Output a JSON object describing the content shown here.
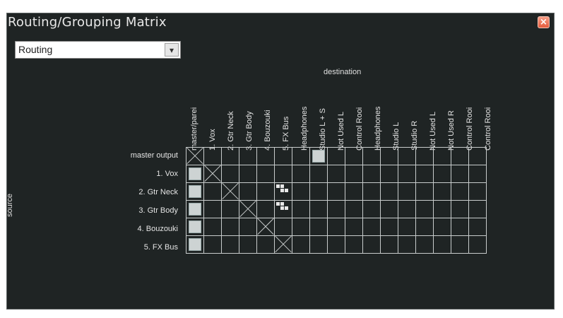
{
  "window": {
    "title": "Routing/Grouping Matrix",
    "close_glyph": "×"
  },
  "mode_select": {
    "value": "Routing",
    "arrow_icon": "chevron-down-icon"
  },
  "destination_label": "destination",
  "source_label": "source",
  "columns": [
    "master/parei",
    "1. Vox",
    "2. Gtr Neck",
    "3. Gtr Body",
    "4. Bouzouki",
    "5. FX Bus",
    "Headphones",
    "Studio L + S",
    "Not Used L",
    "Control Rooi",
    "Headphones",
    "Studio L",
    "Studio R",
    "Not Used L",
    "Not Used R",
    "Control Rooi",
    "Control Rooi"
  ],
  "rows": [
    "master output",
    "1. Vox",
    "2. Gtr Neck",
    "3. Gtr Body",
    "4. Bouzouki",
    "5. FX Bus"
  ],
  "matrix": [
    [
      "diag",
      "",
      "",
      "",
      "",
      "",
      "",
      "on",
      "",
      "",
      "",
      "",
      "",
      "",
      "",
      "",
      ""
    ],
    [
      "on",
      "diag",
      "",
      "",
      "",
      "",
      "",
      "",
      "",
      "",
      "",
      "",
      "",
      "",
      "",
      "",
      ""
    ],
    [
      "on",
      "",
      "diag",
      "",
      "",
      "partial",
      "",
      "",
      "",
      "",
      "",
      "",
      "",
      "",
      "",
      "",
      ""
    ],
    [
      "on",
      "",
      "",
      "diag",
      "",
      "partial",
      "",
      "",
      "",
      "",
      "",
      "",
      "",
      "",
      "",
      "",
      ""
    ],
    [
      "on",
      "",
      "",
      "",
      "diag",
      "",
      "",
      "",
      "",
      "",
      "",
      "",
      "",
      "",
      "",
      "",
      ""
    ],
    [
      "on",
      "",
      "",
      "",
      "",
      "diag",
      "",
      "",
      "",
      "",
      "",
      "",
      "",
      "",
      "",
      "",
      ""
    ]
  ]
}
